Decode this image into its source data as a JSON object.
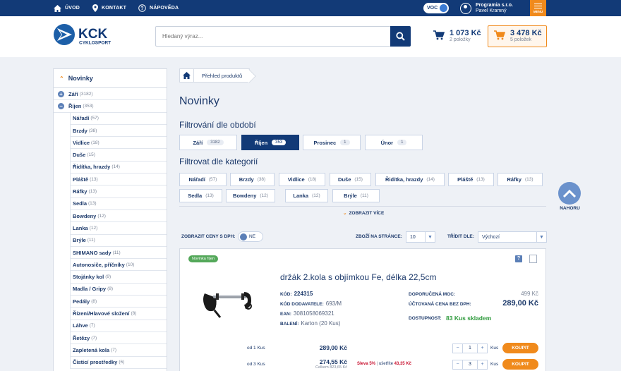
{
  "topbar": {
    "home": "ÚVOD",
    "contact": "KONTAKT",
    "help": "NÁPOVĚDA",
    "voc_label": "VOC",
    "user_company": "Programia s.r.o.",
    "user_name": "Pavel Kramný",
    "menu_label": "MENU"
  },
  "header": {
    "logo_text": "KCK",
    "logo_sub": "CYKLOSPORT",
    "search_placeholder": "Hledaný výraz...",
    "cart1_amount": "1 073 Kč",
    "cart1_count": "2 položky",
    "cart2_amount": "3 478 Kč",
    "cart2_count": "5 položek"
  },
  "sidebar": {
    "title": "Novinky",
    "top_items": [
      {
        "icon": "+",
        "label": "Září",
        "count": "(3182)"
      },
      {
        "icon": "−",
        "label": "Říjen",
        "count": "(353)"
      }
    ],
    "sub_items": [
      {
        "label": "Nářadí",
        "count": "(57)"
      },
      {
        "label": "Brzdy",
        "count": "(38)"
      },
      {
        "label": "Vidlice",
        "count": "(18)"
      },
      {
        "label": "Duše",
        "count": "(15)"
      },
      {
        "label": "Řidítka, hrazdy",
        "count": "(14)"
      },
      {
        "label": "Pláště",
        "count": "(13)"
      },
      {
        "label": "Ráfky",
        "count": "(13)"
      },
      {
        "label": "Sedla",
        "count": "(13)"
      },
      {
        "label": "Bowdeny",
        "count": "(12)"
      },
      {
        "label": "Lanka",
        "count": "(12)"
      },
      {
        "label": "Brýle",
        "count": "(11)"
      },
      {
        "label": "SHIMANO sady",
        "count": "(11)"
      },
      {
        "label": "Autonosiče, příčníky",
        "count": "(10)"
      },
      {
        "label": "Stojánky kol",
        "count": "(9)"
      },
      {
        "label": "Madla / Gripy",
        "count": "(8)"
      },
      {
        "label": "Pedály",
        "count": "(8)"
      },
      {
        "label": "Řízení/Hlavové složení",
        "count": "(8)"
      },
      {
        "label": "Láhve",
        "count": "(7)"
      },
      {
        "label": "Řetězy",
        "count": "(7)"
      },
      {
        "label": "Zapletená kola",
        "count": "(7)"
      },
      {
        "label": "Čisticí prostředky",
        "count": "(6)"
      }
    ]
  },
  "breadcrumb": {
    "item": "Přehled produktů"
  },
  "main": {
    "title": "Novinky",
    "period_title": "Filtrování dle období",
    "periods": [
      {
        "label": "Září",
        "count": "3182"
      },
      {
        "label": "Říjen",
        "count": "353"
      },
      {
        "label": "Prosinec",
        "count": "1"
      },
      {
        "label": "Únor",
        "count": "1"
      }
    ],
    "category_title": "Filtrovat dle kategorií",
    "categories": [
      {
        "label": "Nářadí",
        "count": "(57)"
      },
      {
        "label": "Brzdy",
        "count": "(38)"
      },
      {
        "label": "Vidlice",
        "count": "(18)"
      },
      {
        "label": "Duše",
        "count": "(15)"
      },
      {
        "label": "Řidítka, hrazdy",
        "count": "(14)"
      },
      {
        "label": "Pláště",
        "count": "(13)"
      },
      {
        "label": "Ráfky",
        "count": "(13)"
      },
      {
        "label": "Sedla",
        "count": "(13)"
      },
      {
        "label": "Bowdeny",
        "count": "(12)"
      },
      {
        "label": "Lanka",
        "count": "(12)"
      },
      {
        "label": "Brýle",
        "count": "(11)"
      }
    ],
    "show_more": "ZOBRAZIT VÍCE",
    "to_top": "NAHORU"
  },
  "toolbar": {
    "vat_label": "ZOBRAZIT CENY S DPH:",
    "vat_value": "NE",
    "per_page_label": "ZBOŽÍ NA STRÁNCE:",
    "per_page_value": "10",
    "sort_label": "TŘÍDIT DLE:",
    "sort_value": "Výchozí"
  },
  "product": {
    "tag": "Novinka říjen",
    "help_icon": "?",
    "title": "držák 2.kola s objímkou Fe, délka 22,5cm",
    "code_label": "KÓD:",
    "code": "224315",
    "supplier_code_label": "KÓD DODAVATELE:",
    "supplier_code": "693/M",
    "ean_label": "EAN:",
    "ean": "3081058069321",
    "package_label": "BALENÍ:",
    "package": "Karton (20 Kus)",
    "rrp_label": "DOPORUČENÁ MOC:",
    "rrp": "499 Kč",
    "price_label": "ÚČTOVANÁ CENA BEZ DPH:",
    "price": "289,00 Kč",
    "availability_label": "DOSTUPNOST:",
    "availability": "83 Kus skladem",
    "tiers": [
      {
        "from": "od 1 Kus",
        "price": "289,00 Kč",
        "qty": "1",
        "unit": "Kus",
        "buy": "KOUPIT"
      },
      {
        "from": "od 3 Kus",
        "price": "274,55 Kč",
        "total": "Celkem 823,65 Kč",
        "discount": "Sleva 5%",
        "saving_label": "ušetříte",
        "saving": "43,35 Kč",
        "qty": "3",
        "unit": "Kus",
        "buy": "KOUPIT"
      }
    ]
  },
  "colors": {
    "brand_navy": "#123a77",
    "accent_orange": "#f08a1c",
    "stock_green": "#2e9a3c",
    "discount_red": "#c8102e"
  }
}
